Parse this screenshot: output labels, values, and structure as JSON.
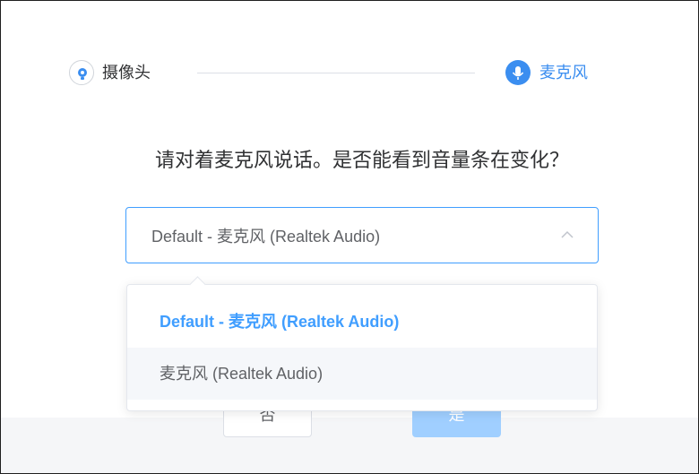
{
  "steps": [
    {
      "label": "摄像头",
      "icon": "camera-icon",
      "active": false
    },
    {
      "label": "麦克风",
      "icon": "microphone-icon",
      "active": true
    }
  ],
  "question": "请对着麦克风说话。是否能看到音量条在变化？",
  "select": {
    "value": "Default - 麦克风 (Realtek Audio)",
    "open": true
  },
  "dropdown": {
    "options": [
      {
        "label": "Default - 麦克风 (Realtek Audio)",
        "selected": true
      },
      {
        "label": "麦克风 (Realtek Audio)",
        "selected": false,
        "hovered": true
      }
    ]
  },
  "buttons": {
    "no_label": "否",
    "yes_label": "是"
  },
  "colors": {
    "accent": "#409eff",
    "step_active": "#3b8ef0",
    "text": "#303133",
    "muted_text": "#606266",
    "yes_button_disabled": "#a0cfff"
  }
}
